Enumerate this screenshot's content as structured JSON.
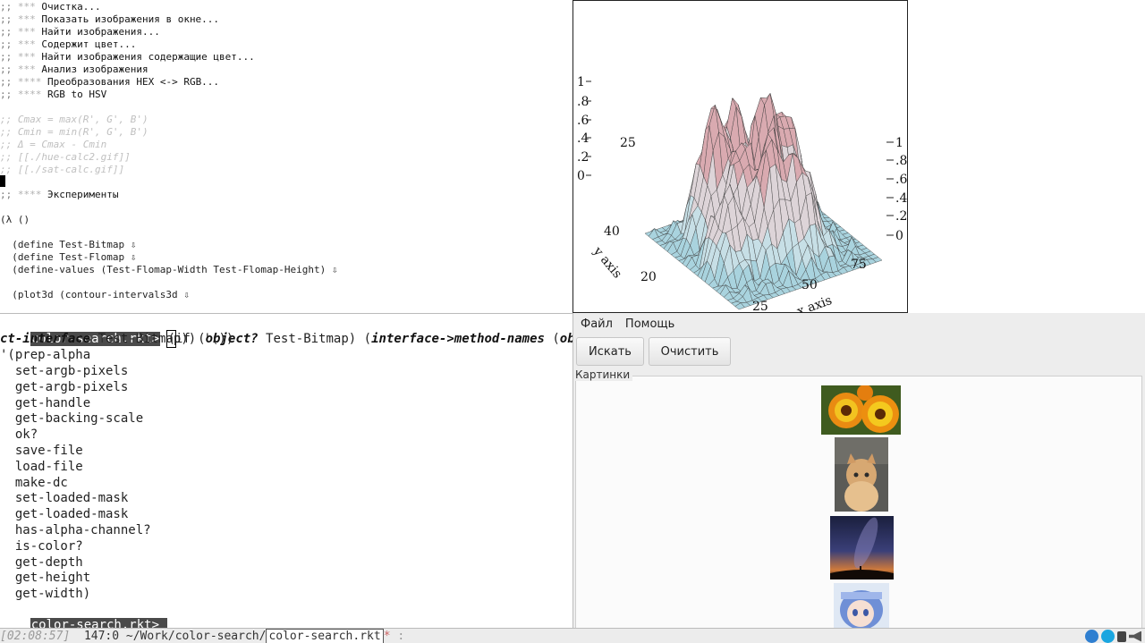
{
  "editor": {
    "lines": [
      {
        "prefix": ";; ",
        "stars": "*** ",
        "text": "Очистка..."
      },
      {
        "prefix": ";; ",
        "stars": "*** ",
        "text": "Показать изображения в окне..."
      },
      {
        "prefix": ";; ",
        "stars": "*** ",
        "text": "Найти изображения..."
      },
      {
        "prefix": ";; ",
        "stars": "*** ",
        "text": "Содержит цвет..."
      },
      {
        "prefix": ";; ",
        "stars": "*** ",
        "text": "Найти изображения содержащие цвет..."
      },
      {
        "prefix": ";; ",
        "stars": "*** ",
        "text": "Анализ изображения"
      },
      {
        "prefix": ";; ",
        "stars": "**** ",
        "text": "Преобразования HEX <-> RGB..."
      },
      {
        "prefix": ";; ",
        "stars": "**** ",
        "text": "RGB to HSV"
      }
    ],
    "comments": [
      ";; Cmax = max(R', G', B')",
      ";; Cmin = min(R', G', B')",
      ";; Δ = Cmax - Cmin",
      ";; [[./hue-calc2.gif]]",
      ";; [[./sat-calc.gif]]"
    ],
    "experiments_prefix": ";; ",
    "experiments_stars": "**** ",
    "experiments_text": "Эксперименты",
    "lambda": "(λ ()",
    "code": [
      "  (define Test-Bitmap ⇩",
      "  (define Test-Flomap ⇩",
      "  (define-values (Test-Flomap-Width Test-Flomap-Height) ⇩",
      "  (plot3d (contour-intervals3d ⇩"
    ]
  },
  "plot": {
    "left_ticks": [
      "1",
      ".8",
      ".6",
      ".4",
      ".2",
      "0"
    ],
    "right_ticks": [
      "1",
      ".8",
      ".6",
      ".4",
      ".2",
      "0"
    ],
    "y_ticks": [
      "25",
      "40",
      "20"
    ],
    "x_ticks": [
      "75",
      "50",
      "25"
    ],
    "y_axis_label": "y axis",
    "x_axis_label": "x axis"
  },
  "repl": {
    "prompt": "color-search.rkt>",
    "input_line1": [
      {
        "t": " ",
        "c": ""
      },
      {
        "t": "(",
        "c": "cursor"
      },
      {
        "t": "if (",
        "c": ""
      },
      {
        "t": "object?",
        "c": "kw"
      },
      {
        "t": " Test-Bitmap) (",
        "c": ""
      },
      {
        "t": "interface->method-names",
        "c": "kw"
      },
      {
        "t": " (",
        "c": ""
      },
      {
        "t": "obje",
        "c": "kw"
      },
      {
        "t": " \\",
        "c": ""
      }
    ],
    "input_line2": [
      {
        "t": "ct-interface",
        "c": "kw"
      },
      {
        "t": " Test-Bitmap)) '())",
        "c": ""
      }
    ],
    "output_first": "'(prep-alpha",
    "methods": [
      "set-argb-pixels",
      "get-argb-pixels",
      "get-handle",
      "get-backing-scale",
      "ok?",
      "save-file",
      "load-file",
      "make-dc",
      "set-loaded-mask",
      "get-loaded-mask",
      "has-alpha-channel?",
      "is-color?",
      "get-depth",
      "get-height",
      "get-width)"
    ]
  },
  "app": {
    "menu": [
      "Файл",
      "Помощь"
    ],
    "search_button": "Искать",
    "clear_button": "Очистить",
    "group_label": "Картинки"
  },
  "modeline": {
    "time": "[02:08:57]",
    "position": "147:0",
    "directory": "~/Work/color-search/",
    "filename": "color-search.rkt",
    "modified": "*",
    "rest": " :"
  },
  "colors": {
    "prompt_bg": "#4a4a4a",
    "surface_pink": "#d9aab0",
    "surface_blue": "#a9d3de"
  }
}
